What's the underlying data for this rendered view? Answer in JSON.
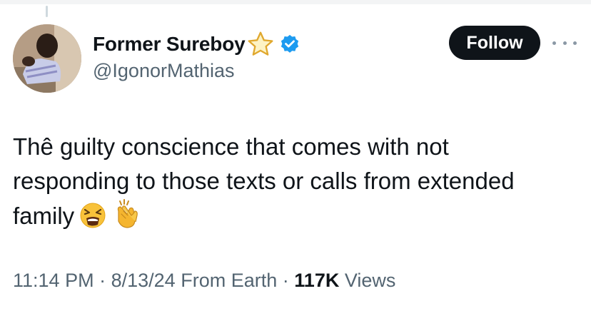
{
  "tweet": {
    "author": {
      "display_name": "Former Sureboy",
      "handle": "@IgonorMathias",
      "badge_icons": [
        "star-icon",
        "verified-icon"
      ],
      "verified_color": "#1d9bf0"
    },
    "follow_label": "Follow",
    "more_icon": "more-horizontal-icon",
    "text_lines": [
      "Thê guilty conscience that comes with not",
      "responding to those texts or calls from extended",
      "family"
    ],
    "emojis": [
      "tired-face-emoji",
      "clapping-hands-emoji"
    ],
    "time": "11:14 PM",
    "date": "8/13/24",
    "source": "From Earth",
    "views_count": "117K",
    "views_label": "Views",
    "separator": "·"
  },
  "colors": {
    "text_primary": "#0f1419",
    "text_secondary": "#536471",
    "follow_bg": "#0f1419",
    "follow_text": "#ffffff"
  }
}
